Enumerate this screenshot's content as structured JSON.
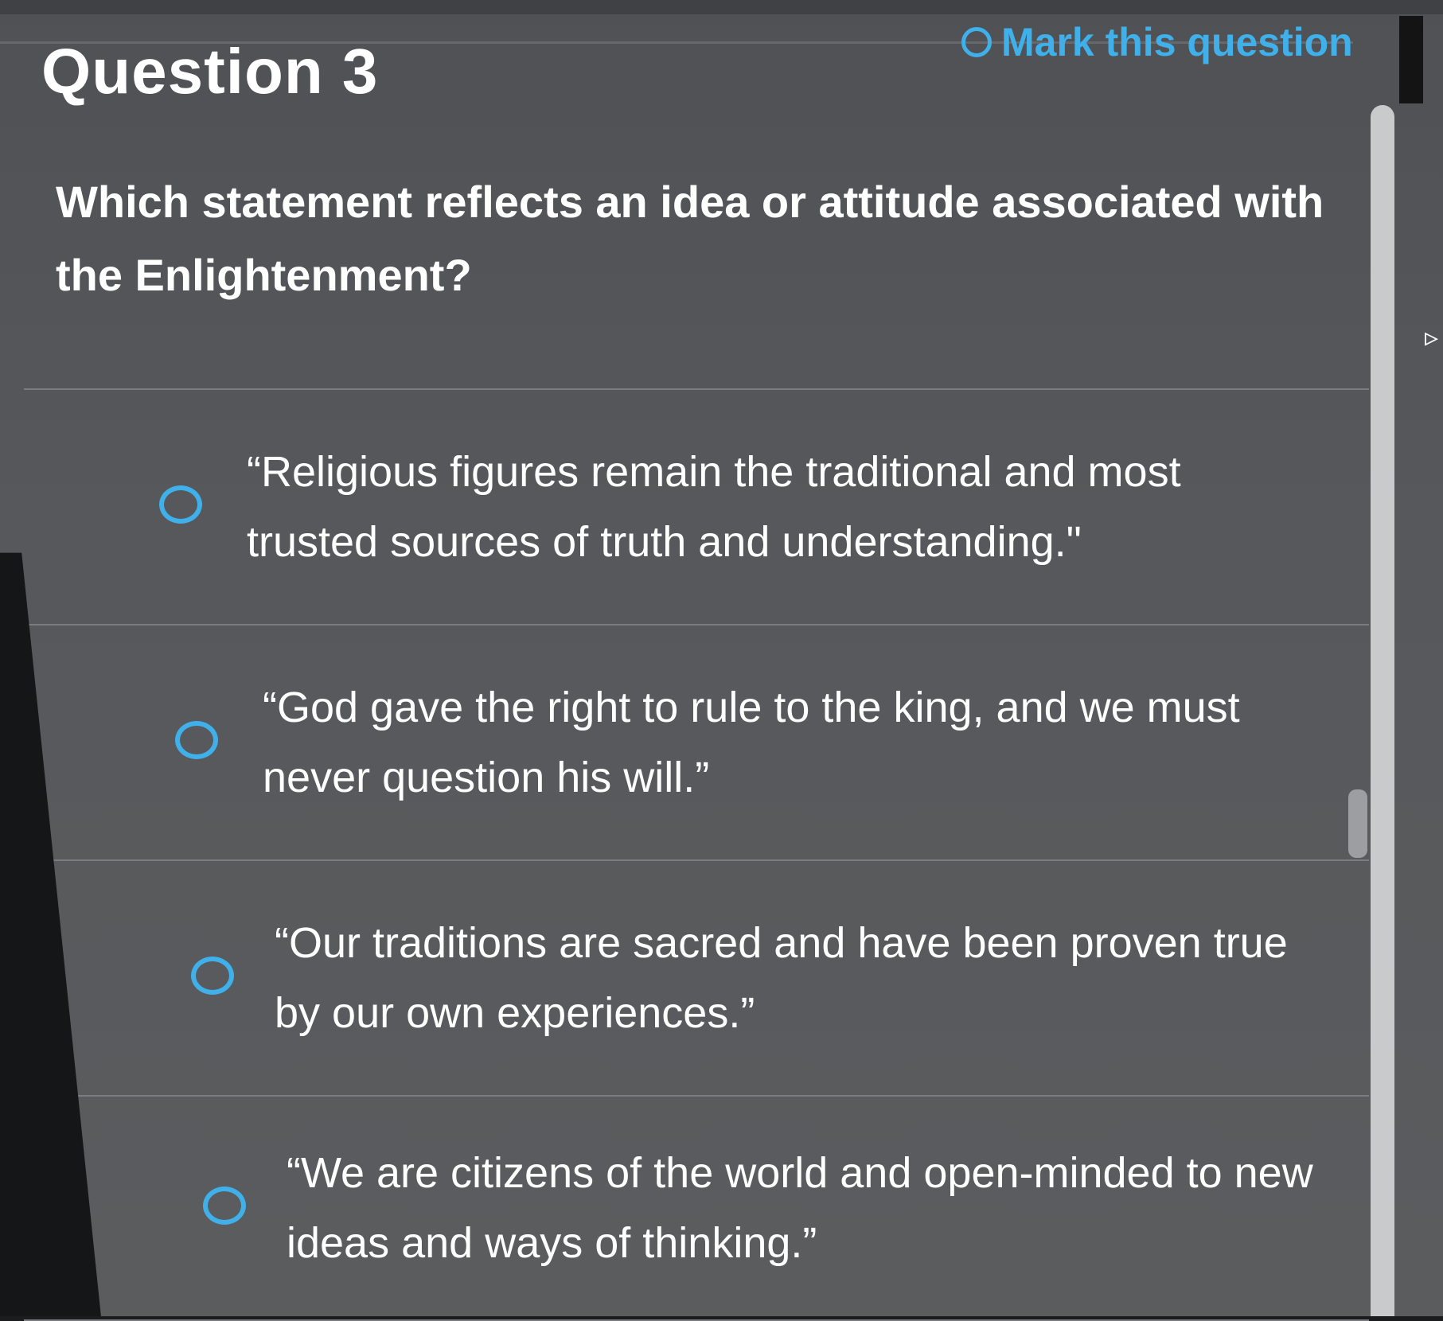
{
  "question": {
    "title": "Question 3",
    "mark_label": "Mark this question",
    "prompt": "Which statement reflects an idea or attitude associated with the Enlightenment?"
  },
  "options": [
    {
      "text": "“Religious figures remain the traditional and most trusted sources of truth and understanding.\""
    },
    {
      "text": "“God gave the right to rule to the king, and we must never question his will.”"
    },
    {
      "text": "“Our traditions are sacred and have been proven true by our own experiences.”"
    },
    {
      "text": "“We are citizens of the world and open-minded to new ideas and ways of thinking.”"
    }
  ],
  "colors": {
    "accent": "#3fb0ea",
    "background": "#56585b",
    "text": "#ffffff"
  }
}
